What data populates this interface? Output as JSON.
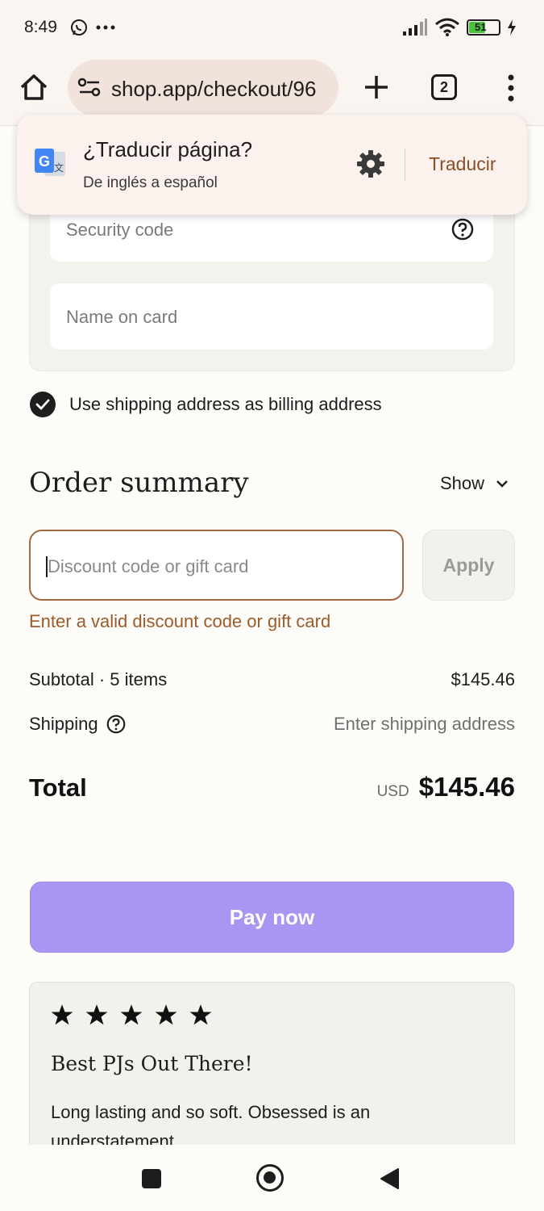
{
  "status_bar": {
    "time": "8:49",
    "battery": "51"
  },
  "browser": {
    "url": "shop.app/checkout/96",
    "tab_count": "2"
  },
  "translate_prompt": {
    "title": "¿Traducir página?",
    "subtitle": "De inglés a español",
    "action": "Traducir"
  },
  "payment": {
    "security_code_placeholder": "Security code",
    "name_on_card_placeholder": "Name on card",
    "billing_same_label": "Use shipping address as billing address"
  },
  "order_summary": {
    "title": "Order summary",
    "toggle_label": "Show",
    "discount_placeholder": "Discount code or gift card",
    "apply_label": "Apply",
    "discount_error": "Enter a valid discount code or gift card",
    "subtotal_label": "Subtotal · 5 items",
    "subtotal_value": "$145.46",
    "shipping_label": "Shipping",
    "shipping_value": "Enter shipping address",
    "total_label": "Total",
    "total_currency": "USD",
    "total_value": "$145.46"
  },
  "pay_button_label": "Pay now",
  "review": {
    "rating": 5,
    "title": "Best PJs Out There!",
    "body": "Long lasting and so soft. Obsessed is an understatement."
  },
  "colors": {
    "accent_brown": "#8c4e23",
    "pay_purple": "#a996f2"
  }
}
